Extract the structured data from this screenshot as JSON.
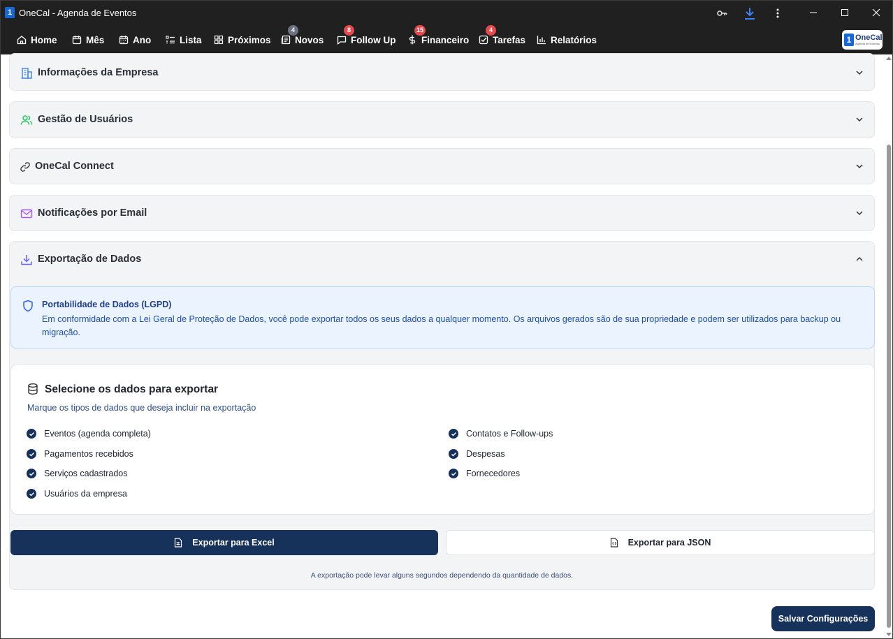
{
  "window": {
    "title": "OneCal - Agenda de Eventos",
    "app_icon_text": "1"
  },
  "nav": {
    "items": [
      {
        "label": "Home",
        "icon": "home-icon",
        "badge": ""
      },
      {
        "label": "Mês",
        "icon": "calendar-icon",
        "badge": ""
      },
      {
        "label": "Ano",
        "icon": "calendar-grid-icon",
        "badge": ""
      },
      {
        "label": "Lista",
        "icon": "list-icon",
        "badge": ""
      },
      {
        "label": "Próximos",
        "icon": "grid-icon",
        "badge": ""
      },
      {
        "label": "Novos",
        "icon": "newspaper-icon",
        "badge": "4"
      },
      {
        "label": "Follow Up",
        "icon": "chat-icon",
        "badge": "8"
      },
      {
        "label": "Financeiro",
        "icon": "dollar-icon",
        "badge": "15"
      },
      {
        "label": "Tarefas",
        "icon": "checkbox-icon",
        "badge": "4"
      },
      {
        "label": "Relatórios",
        "icon": "bar-chart-icon",
        "badge": ""
      }
    ],
    "brand": {
      "num": "1",
      "name": "OneCal",
      "tagline": "Agenda de Eventos"
    }
  },
  "sections": [
    {
      "title": "Informações da Empresa",
      "icon": "building-icon",
      "expanded": false
    },
    {
      "title": "Gestão de Usuários",
      "icon": "users-icon",
      "expanded": false
    },
    {
      "title": "OneCal Connect",
      "icon": "link-icon",
      "expanded": false
    },
    {
      "title": "Notificações por Email",
      "icon": "mail-icon",
      "expanded": false
    },
    {
      "title": "Exportação de Dados",
      "icon": "download-icon",
      "expanded": true
    }
  ],
  "export": {
    "lgpd_title": "Portabilidade de Dados (LGPD)",
    "lgpd_text": "Em conformidade com a Lei Geral de Proteção de Dados, você pode exportar todos os seus dados a qualquer momento. Os arquivos gerados são de sua propriedade e podem ser utilizados para backup ou migração.",
    "card_title": "Selecione os dados para exportar",
    "card_subtitle": "Marque os tipos de dados que deseja incluir na exportação",
    "options": [
      {
        "label": "Eventos (agenda completa)",
        "checked": true
      },
      {
        "label": "Contatos e Follow-ups",
        "checked": true
      },
      {
        "label": "Pagamentos recebidos",
        "checked": true
      },
      {
        "label": "Despesas",
        "checked": true
      },
      {
        "label": "Serviços cadastrados",
        "checked": true
      },
      {
        "label": "Fornecedores",
        "checked": true
      },
      {
        "label": "Usuários da empresa",
        "checked": true
      }
    ],
    "excel_button": "Exportar para Excel",
    "json_button": "Exportar para JSON",
    "note": "A exportação pode levar alguns segundos dependendo da quantidade de dados."
  },
  "save_button": "Salvar Configurações",
  "colors": {
    "titlebar": "#202020",
    "primary": "#16325b",
    "badge_red": "#e5484d",
    "badge_gray": "#6b7280",
    "lgpd_bg": "#eaf3fe"
  }
}
